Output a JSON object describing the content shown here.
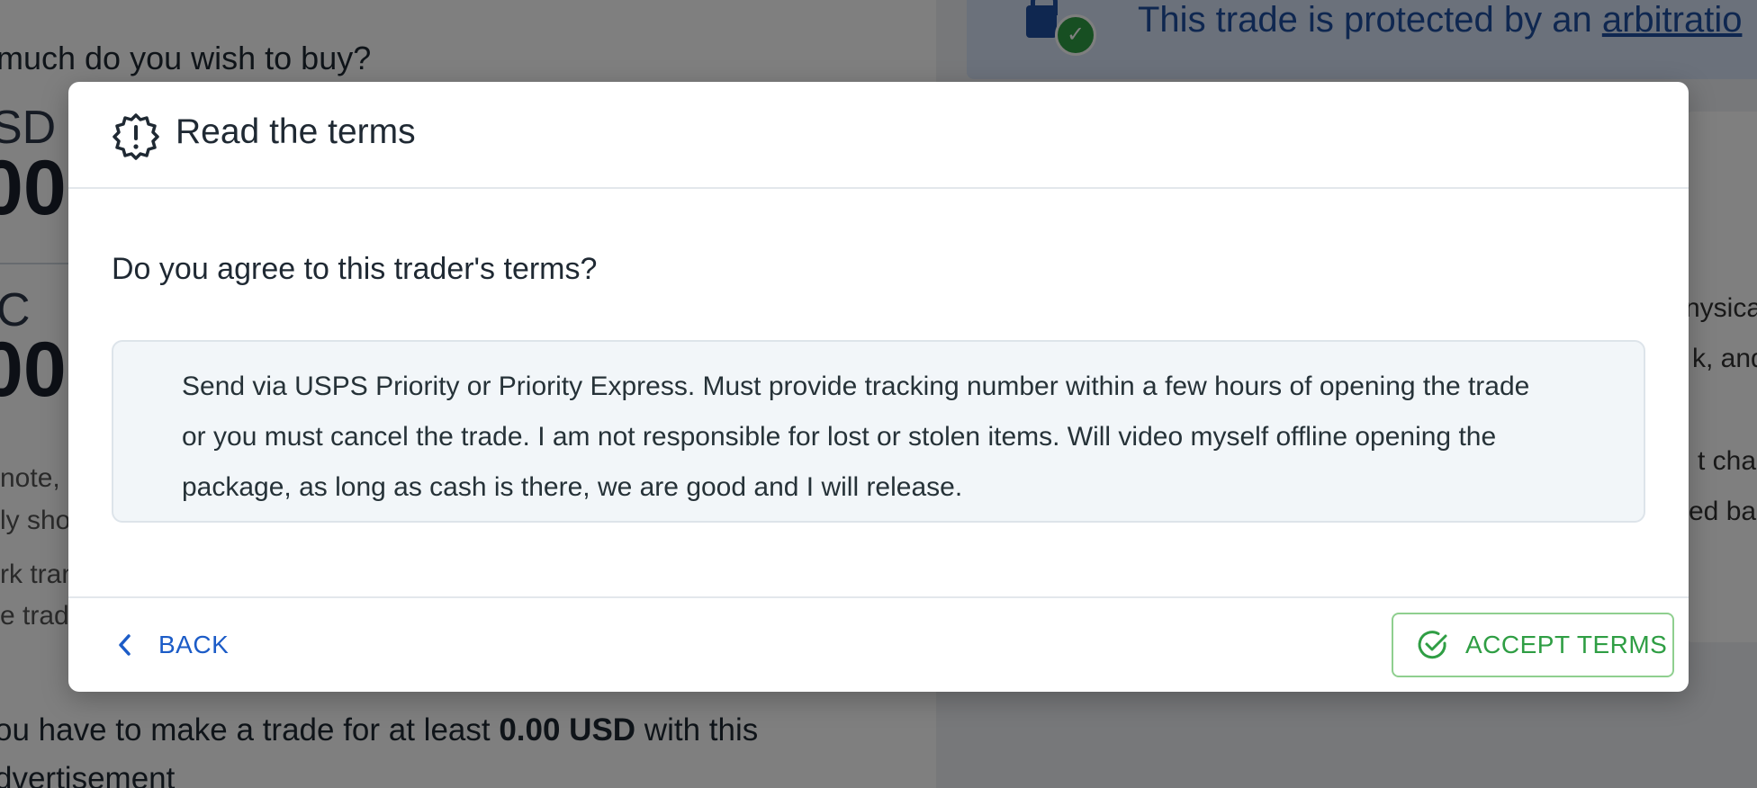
{
  "background": {
    "question": "much do you wish to buy?",
    "currency_1": "SD",
    "amount_1": "00",
    "currency_2": "C",
    "amount_2": "00",
    "notes": [
      "note,",
      "ly sho",
      "rk tran",
      "e trad"
    ],
    "min_trade_prefix": "ou have to make a trade for at least ",
    "min_trade_amount": "0.00 USD",
    "min_trade_suffix": " with this",
    "min_trade_line2": "dvertisement",
    "banner_text_prefix": "This trade is protected by an ",
    "banner_link": "arbitratio",
    "right_fragments": [
      "nysica",
      "k, and",
      "t char",
      "ed bas"
    ]
  },
  "modal": {
    "title": "Read the terms",
    "question": "Do you agree to this trader's terms?",
    "terms": "Send via USPS Priority or Priority Express. Must provide tracking number within a few hours of opening the trade or you must cancel the trade. I am not responsible for lost or stolen items. Will video myself offline opening the package, as long as cash is there, we are good and I will release.",
    "back_label": "BACK",
    "accept_label": "ACCEPT TERMS"
  },
  "colors": {
    "accent_blue": "#1c5cc7",
    "accent_green": "#2f9e44",
    "terms_bg": "#f2f6f9"
  },
  "icons": {
    "header": "alert-badge-icon",
    "back": "chevron-left-icon",
    "accept": "check-circle-icon"
  }
}
